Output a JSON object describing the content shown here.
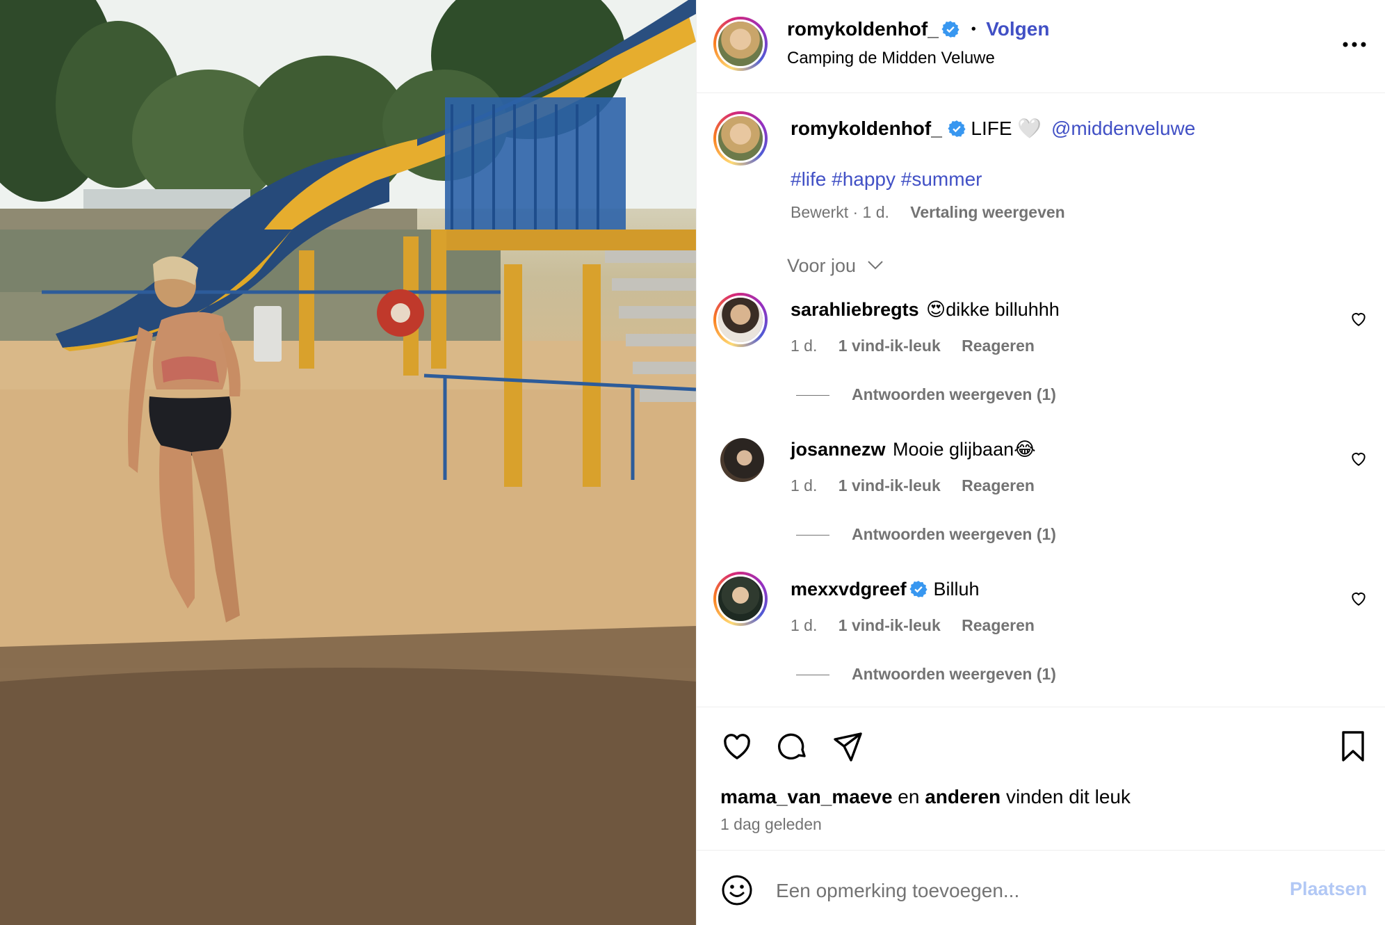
{
  "post": {
    "author": "romykoldenhof_",
    "follow_label": "Volgen",
    "separator": "•",
    "location": "Camping de Midden Veluwe",
    "more_icon": "more-horizontal-icon"
  },
  "caption": {
    "author": "romykoldenhof_",
    "text": "LIFE 🤍",
    "mention": "@middenveluwe",
    "hashtags": "#life #happy #summer",
    "edited": "Bewerkt · 1 d.",
    "translate": "Vertaling weergeven"
  },
  "sort_label": "Voor jou",
  "comments": [
    {
      "user": "sarahliebregts",
      "text": "😍dikke billuhhh",
      "time": "1 d.",
      "likes": "1 vind-ik-leuk",
      "reply": "Reageren",
      "replies": "Antwoorden weergeven (1)",
      "verified": false
    },
    {
      "user": "josannezw",
      "text": "Mooie glijbaan😂",
      "time": "1 d.",
      "likes": "1 vind-ik-leuk",
      "reply": "Reageren",
      "replies": "Antwoorden weergeven (1)",
      "verified": false
    },
    {
      "user": "mexxvdgreef",
      "text": "Billuh",
      "time": "1 d.",
      "likes": "1 vind-ik-leuk",
      "reply": "Reageren",
      "replies": "Antwoorden weergeven (1)",
      "verified": true
    }
  ],
  "likes": {
    "first_user": "mama_van_maeve",
    "connector": "en",
    "others": "anderen",
    "suffix": "vinden dit leuk",
    "time": "1 dag geleden"
  },
  "composer": {
    "placeholder": "Een opmerking toevoegen...",
    "post_label": "Plaatsen"
  },
  "colors": {
    "link": "#4150c5",
    "verified": "#3897f0",
    "muted": "#737373",
    "post_disabled": "#b2c8f5"
  }
}
